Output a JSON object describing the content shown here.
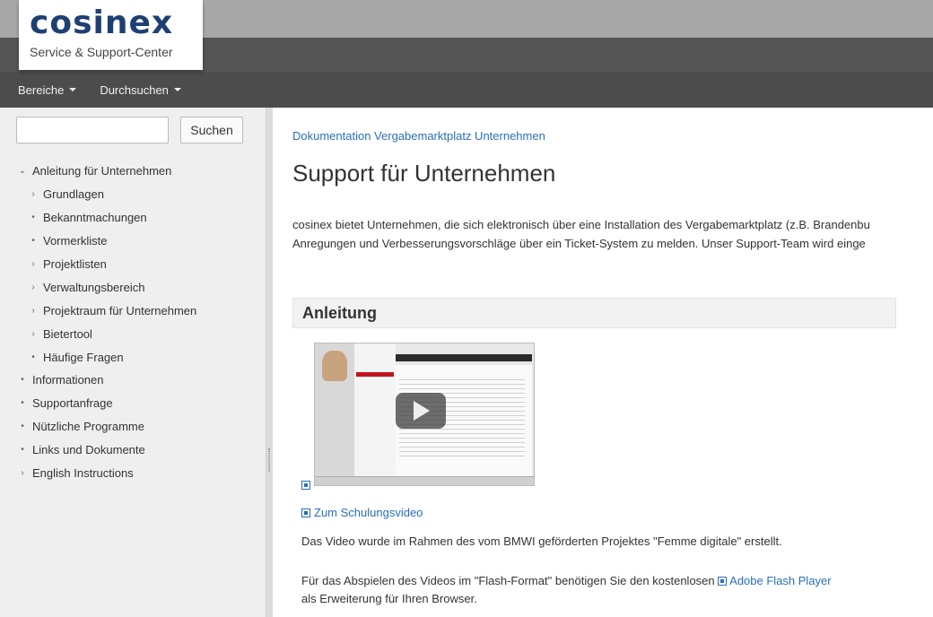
{
  "header": {
    "logo_text": "cosinex",
    "logo_subtitle": "Service & Support-Center",
    "nav": [
      {
        "label": "Bereiche"
      },
      {
        "label": "Durchsuchen"
      }
    ]
  },
  "sidebar": {
    "search_button": "Suchen",
    "search_value": "",
    "items": [
      {
        "label": "Anleitung für Unternehmen",
        "marker": "⌄",
        "level": 0
      },
      {
        "label": "Grundlagen",
        "marker": "›",
        "level": 1
      },
      {
        "label": "Bekanntmachungen",
        "marker": "•",
        "level": 1
      },
      {
        "label": "Vormerkliste",
        "marker": "•",
        "level": 1
      },
      {
        "label": "Projektlisten",
        "marker": "›",
        "level": 1
      },
      {
        "label": "Verwaltungsbereich",
        "marker": "›",
        "level": 1
      },
      {
        "label": "Projektraum für Unternehmen",
        "marker": "›",
        "level": 1
      },
      {
        "label": "Bietertool",
        "marker": "›",
        "level": 1
      },
      {
        "label": "Häufige Fragen",
        "marker": "•",
        "level": 1
      },
      {
        "label": "Informationen",
        "marker": "•",
        "level": 0
      },
      {
        "label": "Supportanfrage",
        "marker": "•",
        "level": 0
      },
      {
        "label": "Nützliche Programme",
        "marker": "•",
        "level": 0
      },
      {
        "label": "Links und Dokumente",
        "marker": "•",
        "level": 0
      },
      {
        "label": "English Instructions",
        "marker": "›",
        "level": 0
      }
    ]
  },
  "main": {
    "breadcrumb": "Dokumentation Vergabemarktplatz Unternehmen",
    "title": "Support für Unternehmen",
    "intro_line1": "cosinex bietet Unternehmen, die sich elektronisch über eine Installation des Vergabemarktplatz (z.B. Brandenbu",
    "intro_line2": "Anregungen und Verbesserungsvorschläge über ein Ticket-System zu melden. Unser Support-Team wird einge",
    "section_title": "Anleitung",
    "video_link": "Zum Schulungsvideo",
    "para1": "Das Video wurde im Rahmen des vom BMWI geförderten Projektes \"Femme digitale\" erstellt.",
    "para2_before": "Für das Abspielen des Videos im \"Flash-Format\" benötigen Sie den kostenlosen ",
    "para2_link": "Adobe Flash Player",
    "para2_after": "als Erweiterung für Ihren Browser."
  },
  "colors": {
    "brand": "#1e3f73",
    "link": "#2a6ebb",
    "navbar": "#4c4c4c"
  }
}
